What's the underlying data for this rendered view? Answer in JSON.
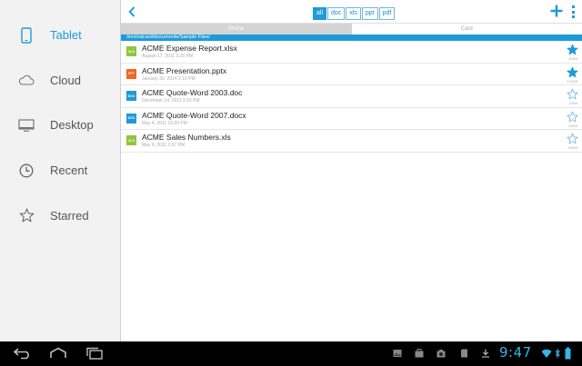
{
  "sidebar": {
    "items": [
      {
        "label": "Tablet",
        "icon": "tablet-icon",
        "active": true
      },
      {
        "label": "Cloud",
        "icon": "cloud-icon",
        "active": false
      },
      {
        "label": "Desktop",
        "icon": "desktop-icon",
        "active": false
      },
      {
        "label": "Recent",
        "icon": "clock-icon",
        "active": false
      },
      {
        "label": "Starred",
        "icon": "star-icon",
        "active": false
      }
    ]
  },
  "toolbar": {
    "filters": [
      {
        "label": "all",
        "active": true
      },
      {
        "label": "doc",
        "active": false
      },
      {
        "label": "xls",
        "active": false
      },
      {
        "label": "ppt",
        "active": false
      },
      {
        "label": "pdf",
        "active": false
      }
    ]
  },
  "tabs": [
    {
      "label": "Phone",
      "active": true
    },
    {
      "label": "Card",
      "active": false
    }
  ],
  "path": "/mnt/sdcard/documents/Sample Files/",
  "files": [
    {
      "badge": "XLS",
      "badge_color": "#8dc63f",
      "name": "ACME Expense Report.xlsx",
      "date": "August 17, 2011 3:29 PM",
      "size": "16KB",
      "starred": true
    },
    {
      "badge": "PPT",
      "badge_color": "#f26522",
      "name": "ACME Presentation.pptx",
      "date": "January 30, 2014 2:19 PM",
      "size": "176KB",
      "starred": true
    },
    {
      "badge": "DOC",
      "badge_color": "#1e9bd7",
      "name": "ACME Quote-Word 2003.doc",
      "date": "December 14, 2011 3:23 PM",
      "size": "19KB",
      "starred": false
    },
    {
      "badge": "DOC",
      "badge_color": "#1e9bd7",
      "name": "ACME Quote-Word 2007.docx",
      "date": "May 4, 2011 10:29 PM",
      "size": "43KB",
      "starred": false
    },
    {
      "badge": "XLS",
      "badge_color": "#8dc63f",
      "name": "ACME Sales Numbers.xls",
      "date": "May 6, 2011 2:57 PM",
      "size": "89KB",
      "starred": false
    }
  ],
  "status": {
    "time": "9:47"
  },
  "colors": {
    "accent": "#1e9bd7",
    "star": "#1e9bd7"
  }
}
